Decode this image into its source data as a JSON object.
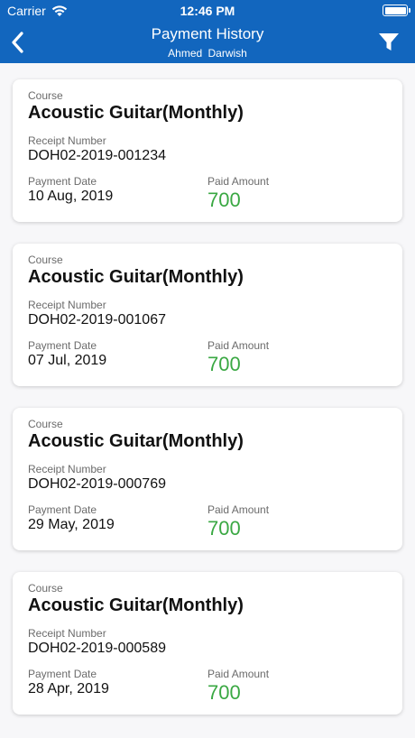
{
  "status_bar": {
    "carrier": "Carrier",
    "time": "12:46 PM"
  },
  "nav": {
    "title": "Payment History",
    "subtitle": "Ahmed  Darwish"
  },
  "colors": {
    "header": "#1266be",
    "amount": "#3aa843"
  },
  "icons": {
    "back": "back-chevron-icon",
    "filter": "filter-icon"
  },
  "labels": {
    "course": "Course",
    "receipt": "Receipt Number",
    "date": "Payment Date",
    "amount": "Paid Amount"
  },
  "payments": [
    {
      "course": "Acoustic Guitar(Monthly)",
      "receipt": "DOH02-2019-001234",
      "date": "10 Aug, 2019",
      "amount": "700"
    },
    {
      "course": "Acoustic Guitar(Monthly)",
      "receipt": "DOH02-2019-001067",
      "date": "07 Jul, 2019",
      "amount": "700"
    },
    {
      "course": "Acoustic Guitar(Monthly)",
      "receipt": "DOH02-2019-000769",
      "date": "29 May, 2019",
      "amount": "700"
    },
    {
      "course": "Acoustic Guitar(Monthly)",
      "receipt": "DOH02-2019-000589",
      "date": "28 Apr, 2019",
      "amount": "700"
    }
  ]
}
